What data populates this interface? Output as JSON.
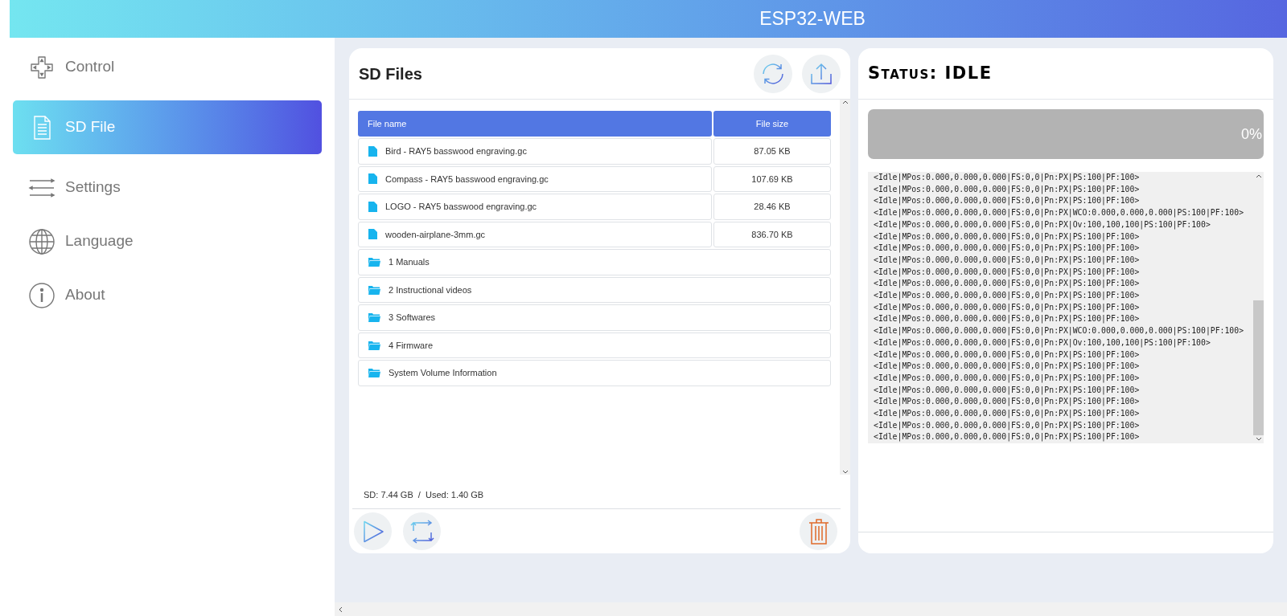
{
  "app": {
    "title": "ESP32-WEB"
  },
  "sidebar": {
    "items": [
      {
        "kind": "control",
        "label": "Control",
        "selected": false
      },
      {
        "kind": "sdfile",
        "label": "SD File",
        "selected": true
      },
      {
        "kind": "settings",
        "label": "Settings",
        "selected": false
      },
      {
        "kind": "language",
        "label": "Language",
        "selected": false
      },
      {
        "kind": "about",
        "label": "About",
        "selected": false
      }
    ]
  },
  "files_panel": {
    "title": "SD Files",
    "table": {
      "columns": [
        "File name",
        "File size"
      ],
      "rows": [
        {
          "kind": "file",
          "name": "Bird - RAY5 basswood engraving.gc",
          "size": "87.05 KB"
        },
        {
          "kind": "file",
          "name": "Compass - RAY5 basswood engraving.gc",
          "size": "107.69 KB"
        },
        {
          "kind": "file",
          "name": "LOGO - RAY5 basswood engraving.gc",
          "size": "28.46 KB"
        },
        {
          "kind": "file",
          "name": "wooden-airplane-3mm.gc",
          "size": "836.70 KB"
        },
        {
          "kind": "folder",
          "name": "1 Manuals"
        },
        {
          "kind": "folder",
          "name": "2 Instructional videos"
        },
        {
          "kind": "folder",
          "name": "3 Softwares"
        },
        {
          "kind": "folder",
          "name": "4 Firmware"
        },
        {
          "kind": "folder",
          "name": "System Volume Information"
        }
      ]
    },
    "storage": "SD: 7.44 GB  /  Used: 1.40 GB"
  },
  "status_panel": {
    "title": "Status: IDLE",
    "progress": {
      "level": 0,
      "reading": "0%"
    },
    "log": [
      "<Idle|MPos:0.000,0.000,0.000|FS:0,0|Pn:PX|PS:100|PF:100>",
      "<Idle|MPos:0.000,0.000,0.000|FS:0,0|Pn:PX|PS:100|PF:100>",
      "<Idle|MPos:0.000,0.000,0.000|FS:0,0|Pn:PX|PS:100|PF:100>",
      "<Idle|MPos:0.000,0.000,0.000|FS:0,0|Pn:PX|WCO:0.000,0.000,0.000|PS:100|PF:100>",
      "<Idle|MPos:0.000,0.000,0.000|FS:0,0|Pn:PX|Ov:100,100,100|PS:100|PF:100>",
      "<Idle|MPos:0.000,0.000,0.000|FS:0,0|Pn:PX|PS:100|PF:100>",
      "<Idle|MPos:0.000,0.000,0.000|FS:0,0|Pn:PX|PS:100|PF:100>",
      "<Idle|MPos:0.000,0.000,0.000|FS:0,0|Pn:PX|PS:100|PF:100>",
      "<Idle|MPos:0.000,0.000,0.000|FS:0,0|Pn:PX|PS:100|PF:100>",
      "<Idle|MPos:0.000,0.000,0.000|FS:0,0|Pn:PX|PS:100|PF:100>",
      "<Idle|MPos:0.000,0.000,0.000|FS:0,0|Pn:PX|PS:100|PF:100>",
      "<Idle|MPos:0.000,0.000,0.000|FS:0,0|Pn:PX|PS:100|PF:100>",
      "<Idle|MPos:0.000,0.000,0.000|FS:0,0|Pn:PX|PS:100|PF:100>",
      "<Idle|MPos:0.000,0.000,0.000|FS:0,0|Pn:PX|WCO:0.000,0.000,0.000|PS:100|PF:100>",
      "<Idle|MPos:0.000,0.000,0.000|FS:0,0|Pn:PX|Ov:100,100,100|PS:100|PF:100>",
      "<Idle|MPos:0.000,0.000,0.000|FS:0,0|Pn:PX|PS:100|PF:100>",
      "<Idle|MPos:0.000,0.000,0.000|FS:0,0|Pn:PX|PS:100|PF:100>",
      "<Idle|MPos:0.000,0.000,0.000|FS:0,0|Pn:PX|PS:100|PF:100>",
      "<Idle|MPos:0.000,0.000,0.000|FS:0,0|Pn:PX|PS:100|PF:100>",
      "<Idle|MPos:0.000,0.000,0.000|FS:0,0|Pn:PX|PS:100|PF:100>",
      "<Idle|MPos:0.000,0.000,0.000|FS:0,0|Pn:PX|PS:100|PF:100>",
      "<Idle|MPos:0.000,0.000,0.000|FS:0,0|Pn:PX|PS:100|PF:100>",
      "<Idle|MPos:0.000,0.000,0.000|FS:0,0|Pn:PX|PS:100|PF:100>"
    ]
  }
}
